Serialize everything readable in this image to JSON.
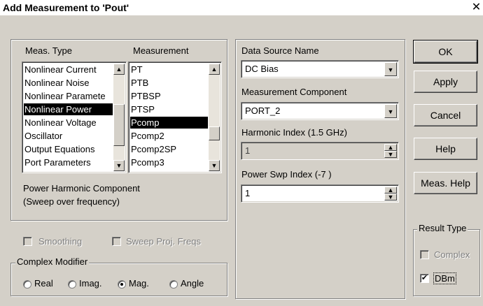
{
  "window": {
    "title": "Add Measurement to 'Pout'",
    "close_icon": "close-icon"
  },
  "left_panel": {
    "meas_type_header": "Meas. Type",
    "measurement_header": "Measurement",
    "meas_types": [
      "Nonlinear Current",
      "Nonlinear Noise",
      "Nonlinear Paramete",
      "Nonlinear Power",
      "Nonlinear Voltage",
      "Oscillator",
      "Output Equations",
      "Port Parameters"
    ],
    "meas_type_selected": "Nonlinear Power",
    "measurements": [
      "PT",
      "PTB",
      "PTBSP",
      "PTSP",
      "Pcomp",
      "Pcomp2",
      "Pcomp2SP",
      "Pcomp3"
    ],
    "measurement_selected": "Pcomp",
    "description_line1": "Power Harmonic Component",
    "description_line2": "(Sweep over frequency)",
    "smoothing_label": "Smoothing",
    "sweep_proj_label": "Sweep Proj. Freqs",
    "complex_modifier": {
      "title": "Complex Modifier",
      "options": [
        "Real",
        "Imag.",
        "Mag.",
        "Angle"
      ],
      "selected": "Mag."
    }
  },
  "middle_panel": {
    "data_source_label": "Data Source Name",
    "data_source_value": "DC Bias",
    "measurement_component_label": "Measurement Component",
    "measurement_component_value": "PORT_2",
    "harmonic_index_label": "Harmonic Index (1.5 GHz)",
    "harmonic_index_value": "1",
    "power_swp_label": "Power Swp Index (-7 )",
    "power_swp_value": "1"
  },
  "buttons": {
    "ok": "OK",
    "apply": "Apply",
    "cancel": "Cancel",
    "help": "Help",
    "meas_help": "Meas. Help"
  },
  "result_type": {
    "title": "Result Type",
    "complex_label": "Complex",
    "complex_checked": false,
    "dbm_label": "DBm",
    "dbm_checked": true
  }
}
